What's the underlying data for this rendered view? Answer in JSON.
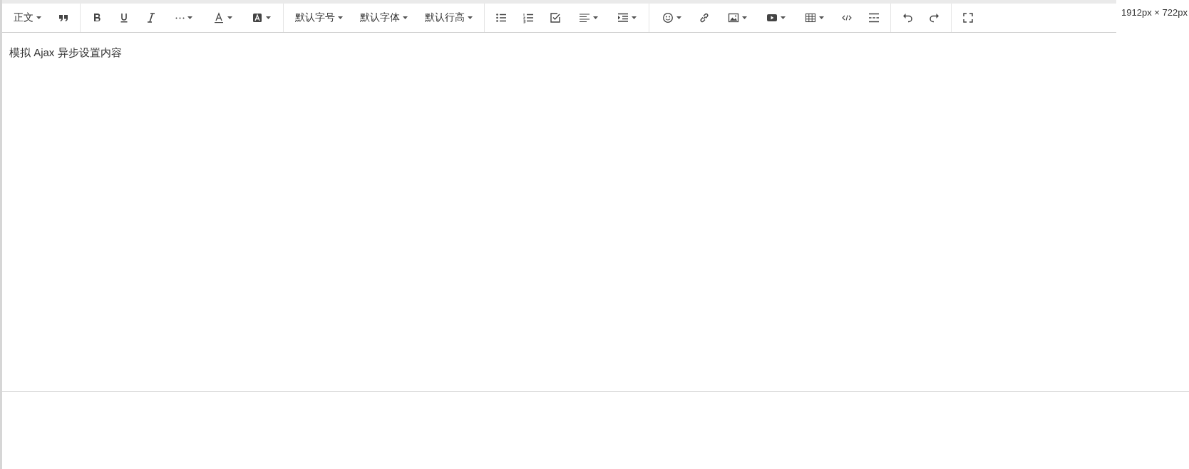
{
  "toolbar": {
    "groups": [
      {
        "items": [
          {
            "kind": "text",
            "label": "正文",
            "dropdown": true
          },
          {
            "kind": "quote",
            "dropdown": false
          }
        ]
      },
      {
        "items": [
          {
            "kind": "bold",
            "dropdown": false
          },
          {
            "kind": "underline",
            "dropdown": false
          },
          {
            "kind": "italic",
            "dropdown": false
          },
          {
            "kind": "more",
            "dropdown": true
          },
          {
            "kind": "font-color",
            "dropdown": true
          },
          {
            "kind": "bg-color",
            "dropdown": true
          }
        ]
      },
      {
        "items": [
          {
            "kind": "text",
            "label": "默认字号",
            "dropdown": true
          },
          {
            "kind": "text",
            "label": "默认字体",
            "dropdown": true
          },
          {
            "kind": "text",
            "label": "默认行高",
            "dropdown": true
          }
        ]
      },
      {
        "items": [
          {
            "kind": "bullet-list",
            "dropdown": false
          },
          {
            "kind": "numbered-list",
            "dropdown": false
          },
          {
            "kind": "todo",
            "dropdown": false
          },
          {
            "kind": "align",
            "dropdown": true
          },
          {
            "kind": "indent",
            "dropdown": true
          }
        ]
      },
      {
        "items": [
          {
            "kind": "emoji",
            "dropdown": true
          },
          {
            "kind": "link",
            "dropdown": false
          },
          {
            "kind": "image",
            "dropdown": true
          },
          {
            "kind": "video",
            "dropdown": true
          },
          {
            "kind": "table",
            "dropdown": true
          },
          {
            "kind": "code",
            "dropdown": false
          },
          {
            "kind": "divider",
            "dropdown": false
          }
        ]
      },
      {
        "items": [
          {
            "kind": "undo",
            "dropdown": false
          },
          {
            "kind": "redo",
            "dropdown": false
          }
        ]
      },
      {
        "items": [
          {
            "kind": "fullscreen",
            "dropdown": false
          }
        ]
      }
    ]
  },
  "editor": {
    "content": "模拟 Ajax 异步设置内容"
  },
  "size_label": "1912px × 722px"
}
